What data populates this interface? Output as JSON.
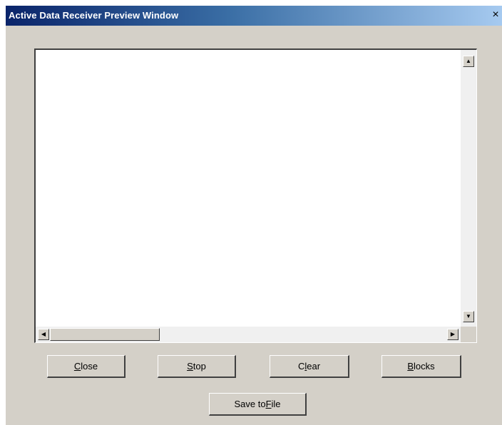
{
  "window": {
    "title": "Active Data Receiver Preview Window",
    "close_glyph": "×"
  },
  "output": {
    "text": ""
  },
  "scrollbars": {
    "up_arrow": "▲",
    "down_arrow": "▼",
    "left_arrow": "◀",
    "right_arrow": "▶"
  },
  "buttons": {
    "close": {
      "mnemonic": "C",
      "rest": "lose"
    },
    "stop": {
      "mnemonic": "S",
      "rest": "top"
    },
    "clear": {
      "pre": "C",
      "mnemonic": "l",
      "rest": "ear"
    },
    "blocks": {
      "mnemonic": "B",
      "rest": "locks"
    },
    "save": {
      "pre": "Save to ",
      "mnemonic": "F",
      "rest": "ile"
    }
  },
  "colors": {
    "face": "#d4d0c8",
    "title_start": "#0a246a",
    "title_end": "#a6caf0"
  }
}
